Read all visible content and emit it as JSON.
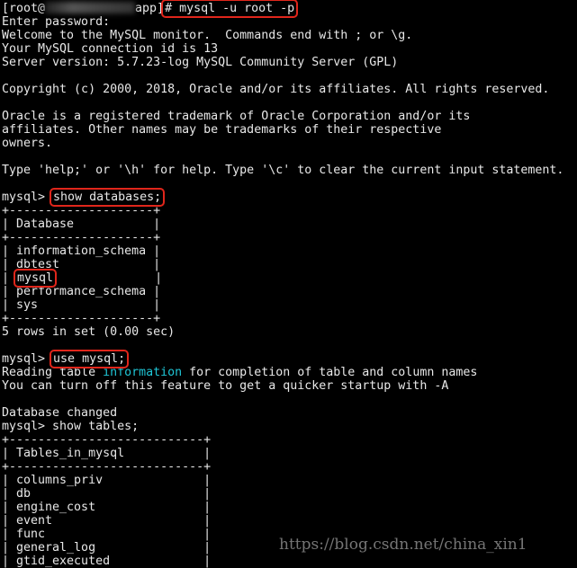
{
  "terminal": {
    "lines": [
      [
        {
          "t": "[root@"
        },
        {
          "t": "",
          "s": "blur"
        },
        {
          "t": "app]"
        },
        {
          "t": "# mysql -u root -p",
          "s": "boxed"
        }
      ],
      [
        {
          "t": "Enter password:"
        }
      ],
      [
        {
          "t": "Welcome to the MySQL monitor.  Commands end with ; or \\g."
        }
      ],
      [
        {
          "t": "Your MySQL connection id is 13"
        }
      ],
      [
        {
          "t": "Server version: 5.7.23-log MySQL Community Server (GPL)"
        }
      ],
      [
        {
          "t": ""
        }
      ],
      [
        {
          "t": "Copyright (c) 2000, 2018, Oracle and/or its affiliates. All rights reserved."
        }
      ],
      [
        {
          "t": ""
        }
      ],
      [
        {
          "t": "Oracle is a registered trademark of Oracle Corporation and/or its"
        }
      ],
      [
        {
          "t": "affiliates. Other names may be trademarks of their respective"
        }
      ],
      [
        {
          "t": "owners."
        }
      ],
      [
        {
          "t": ""
        }
      ],
      [
        {
          "t": "Type 'help;' or '\\h' for help. Type '\\c' to clear the current input statement."
        }
      ],
      [
        {
          "t": ""
        }
      ],
      [
        {
          "t": "mysql> "
        },
        {
          "t": "show databases;",
          "s": "boxed"
        }
      ],
      [
        {
          "t": "+--------------------+"
        }
      ],
      [
        {
          "t": "| Database           |"
        }
      ],
      [
        {
          "t": "+--------------------+"
        }
      ],
      [
        {
          "t": "| information_schema |"
        }
      ],
      [
        {
          "t": "| dbtest             |"
        }
      ],
      [
        {
          "t": "| "
        },
        {
          "t": "mysql",
          "s": "boxed"
        },
        {
          "t": "              |"
        }
      ],
      [
        {
          "t": "| performance_schema |"
        }
      ],
      [
        {
          "t": "| sys                |"
        }
      ],
      [
        {
          "t": "+--------------------+"
        }
      ],
      [
        {
          "t": "5 rows in set (0.00 sec)"
        }
      ],
      [
        {
          "t": ""
        }
      ],
      [
        {
          "t": "mysql> "
        },
        {
          "t": "use mysql;",
          "s": "boxed"
        }
      ],
      [
        {
          "t": "Reading table "
        },
        {
          "t": "information",
          "s": "cyan"
        },
        {
          "t": " for completion of table and column names"
        }
      ],
      [
        {
          "t": "You can turn off this feature to get a quicker startup with -A"
        }
      ],
      [
        {
          "t": ""
        }
      ],
      [
        {
          "t": "Database changed"
        }
      ],
      [
        {
          "t": "mysql> show tables;"
        }
      ],
      [
        {
          "t": "+---------------------------+"
        }
      ],
      [
        {
          "t": "| Tables_in_mysql           |"
        }
      ],
      [
        {
          "t": "+---------------------------+"
        }
      ],
      [
        {
          "t": "| columns_priv              |"
        }
      ],
      [
        {
          "t": "| db                        |"
        }
      ],
      [
        {
          "t": "| engine_cost               |"
        }
      ],
      [
        {
          "t": "| event                     |"
        }
      ],
      [
        {
          "t": "| func                      |"
        }
      ],
      [
        {
          "t": "| general_log               |"
        }
      ],
      [
        {
          "t": "| gtid_executed             |"
        }
      ]
    ]
  },
  "watermark": "https://blog.csdn.net/china_xin1",
  "colors": {
    "background": "#000000",
    "text": "#e8e8e8",
    "highlight_box": "#e0261b",
    "keyword": "#1fc6d6"
  }
}
